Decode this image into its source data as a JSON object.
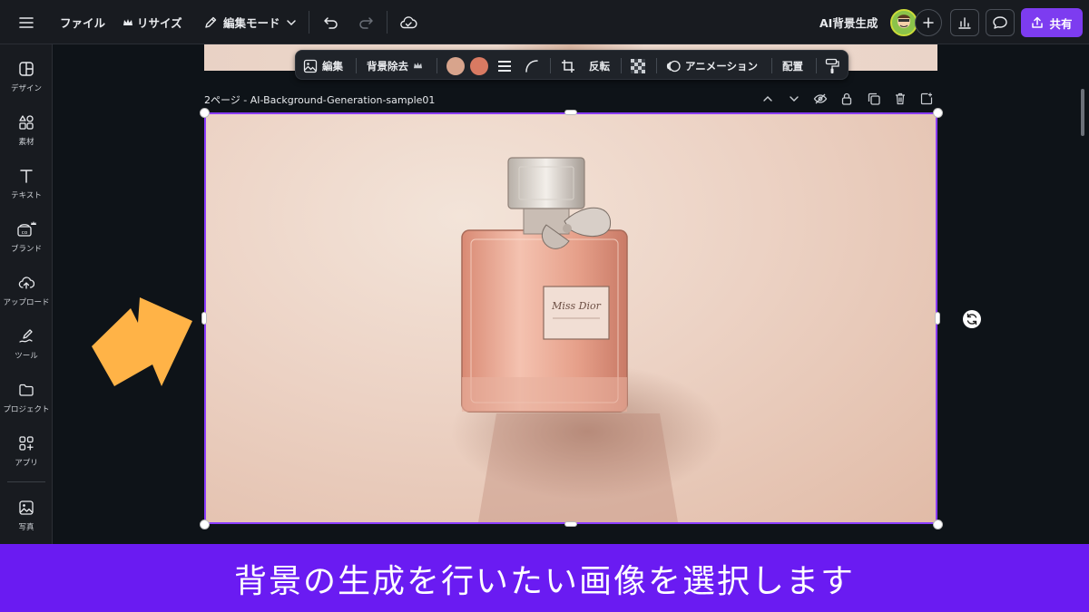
{
  "topbar": {
    "file_label": "ファイル",
    "resize_label": "リサイズ",
    "mode_label": "編集モード",
    "ai_bg_label": "AI背景生成",
    "share_label": "共有"
  },
  "sidebar": {
    "items": [
      {
        "label": "デザイン",
        "icon": "layout-icon"
      },
      {
        "label": "素材",
        "icon": "elements-icon"
      },
      {
        "label": "テキスト",
        "icon": "text-icon"
      },
      {
        "label": "ブランド",
        "icon": "brand-icon"
      },
      {
        "label": "アップロード",
        "icon": "upload-cloud-icon"
      },
      {
        "label": "ツール",
        "icon": "draw-icon"
      },
      {
        "label": "プロジェクト",
        "icon": "folder-icon"
      },
      {
        "label": "アプリ",
        "icon": "apps-icon"
      },
      {
        "label": "写真",
        "icon": "photo-icon"
      }
    ]
  },
  "context_toolbar": {
    "edit_label": "編集",
    "bg_remove_label": "背景除去",
    "flip_label": "反転",
    "animation_label": "アニメーション",
    "position_label": "配置",
    "swatch_colors": [
      "#d8a48c",
      "#d97a62"
    ]
  },
  "page": {
    "title": "2ページ - AI-Background-Generation-sample01"
  },
  "caption": {
    "text": "背景の生成を行いたい画像を選択します"
  },
  "colors": {
    "accent": "#8b3dff",
    "share_button": "#7d3cf0",
    "caption_bg": "#6a1bf2",
    "arrow": "#ffb347"
  }
}
